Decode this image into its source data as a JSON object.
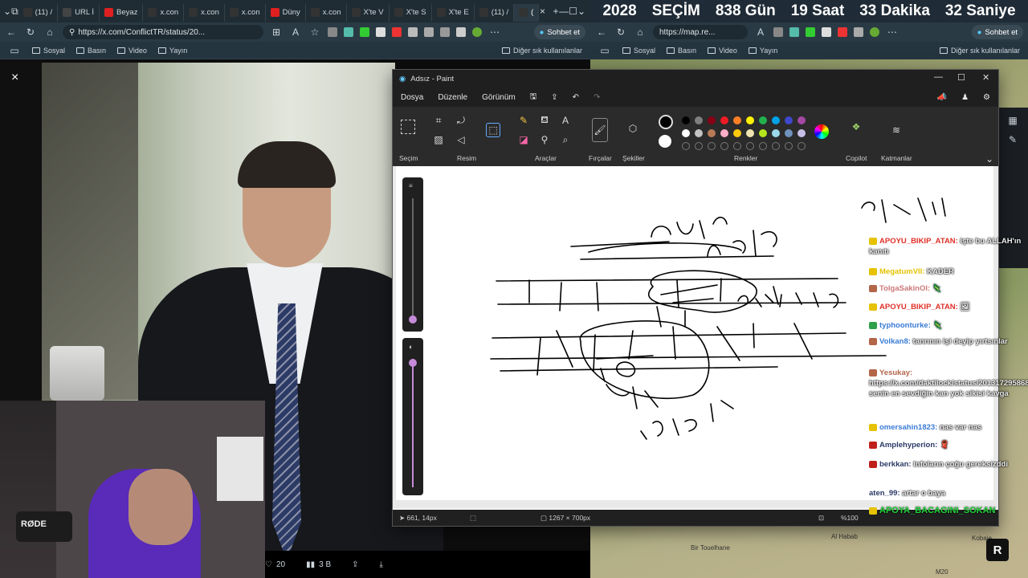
{
  "left_browser": {
    "tabs": [
      {
        "label": "(11) / ",
        "color": "#333"
      },
      {
        "label": "URL İ",
        "color": "#444"
      },
      {
        "label": "Beyaz",
        "color": "#e02020"
      },
      {
        "label": "x.con",
        "color": "#333"
      },
      {
        "label": "x.con",
        "color": "#333"
      },
      {
        "label": "x.con",
        "color": "#333"
      },
      {
        "label": "Düny",
        "color": "#e02020"
      },
      {
        "label": "x.con",
        "color": "#333"
      },
      {
        "label": "X'te V",
        "color": "#333"
      },
      {
        "label": "X'te S",
        "color": "#333"
      },
      {
        "label": "X'te E",
        "color": "#333"
      },
      {
        "label": "(11) /",
        "color": "#333"
      },
      {
        "label": "(",
        "color": "#333"
      }
    ],
    "url": "https://x.com/ConflictTR/status/20...",
    "chat_button": "Sohbet et",
    "bookmarks": [
      "Sosyal",
      "Basın",
      "Video",
      "Yayın"
    ],
    "other_bookmarks": "Diğer sık kullanılanlar"
  },
  "video": {
    "close_icon": "×",
    "mic_brand": "RØDE",
    "tweet_actions": {
      "likes": "20",
      "views": "3 B"
    }
  },
  "right_browser": {
    "countdown": [
      "2028",
      "SEÇİM",
      "838 Gün",
      "19 Saat",
      "33 Dakika",
      "32 Saniye"
    ],
    "url": "https://map.re...",
    "chat_button": "Sohbet et",
    "bookmarks": [
      "Sosyal",
      "Basın",
      "Video",
      "Yayın"
    ],
    "other_bookmarks": "Diğer sık kullanılanlar",
    "map_labels": [
      "Al Habab",
      "Bir Touelhane",
      "Kobaje",
      "M20"
    ],
    "badge": "R"
  },
  "paint": {
    "title": "Adsız - Paint",
    "menu": [
      "Dosya",
      "Düzenle",
      "Görünüm"
    ],
    "groups": [
      "Seçim",
      "Resim",
      "Araçlar",
      "Fırçalar",
      "Şekiller",
      "Renkler",
      "Copilot",
      "Katmanlar"
    ],
    "status": {
      "cursor": "661, 14px",
      "size": "1267 × 700px",
      "zoom": "%100"
    },
    "colors_row1": [
      "#000000",
      "#7f7f7f",
      "#880015",
      "#ed1c24",
      "#ff7f27",
      "#fff200",
      "#22b14c",
      "#00a2e8",
      "#3f48cc",
      "#a349a4"
    ],
    "colors_row2": [
      "#ffffff",
      "#c3c3c3",
      "#b97a57",
      "#ffaec9",
      "#ffc90e",
      "#efe4b0",
      "#b5e61d",
      "#99d9ea",
      "#7092be",
      "#c8bfe7"
    ]
  },
  "chat": {
    "messages": [
      {
        "user": "APOYU_BIKIP_ATAN:",
        "text": "işte bu ALLAH'ın kanıtı",
        "ucls": "u-red",
        "badge": "#e6c200"
      },
      {
        "user": "MegatumVII:",
        "text": "KADER",
        "ucls": "u-yellow",
        "badge": "#e6c200"
      },
      {
        "user": "TolgaSakinOl:",
        "text": "🦎",
        "ucls": "u-pink",
        "badge": "#b3654a"
      },
      {
        "user": "APOYU_BIKIP_ATAN:",
        "text": "🖼",
        "ucls": "u-red",
        "badge": "#e6c200"
      },
      {
        "user": "typhoonturke:",
        "text": "🦎",
        "ucls": "u-blue",
        "badge": "#2ea04a"
      },
      {
        "user": "Volkan8:",
        "text": "tanrının işi deyip yırtsınlar",
        "ucls": "u-blue",
        "badge": "#b3654a"
      },
      {
        "user": "Yesukay:",
        "text": "https://x.com/daktilock/status/2013172958689120664 senin en sevdiğin kan yok sikisi kavga",
        "ucls": "u-brown",
        "badge": "#b3654a"
      },
      {
        "user": "omersahin1823:",
        "text": "nas var nas",
        "ucls": "u-blue",
        "badge": "#e6c200"
      },
      {
        "user": "Amplehyperion:",
        "text": "🧣",
        "ucls": "u-dark",
        "badge": "#c0201a"
      },
      {
        "user": "berkkan:",
        "text": "infoların çoğu gereksizddi",
        "ucls": "u-dark",
        "badge": "#c0201a"
      },
      {
        "user": "aten_99:",
        "text": "artar o baya",
        "ucls": "u-dark",
        "badge": ""
      }
    ],
    "footer": "APOYA_BACAGINI_SOKAN"
  }
}
